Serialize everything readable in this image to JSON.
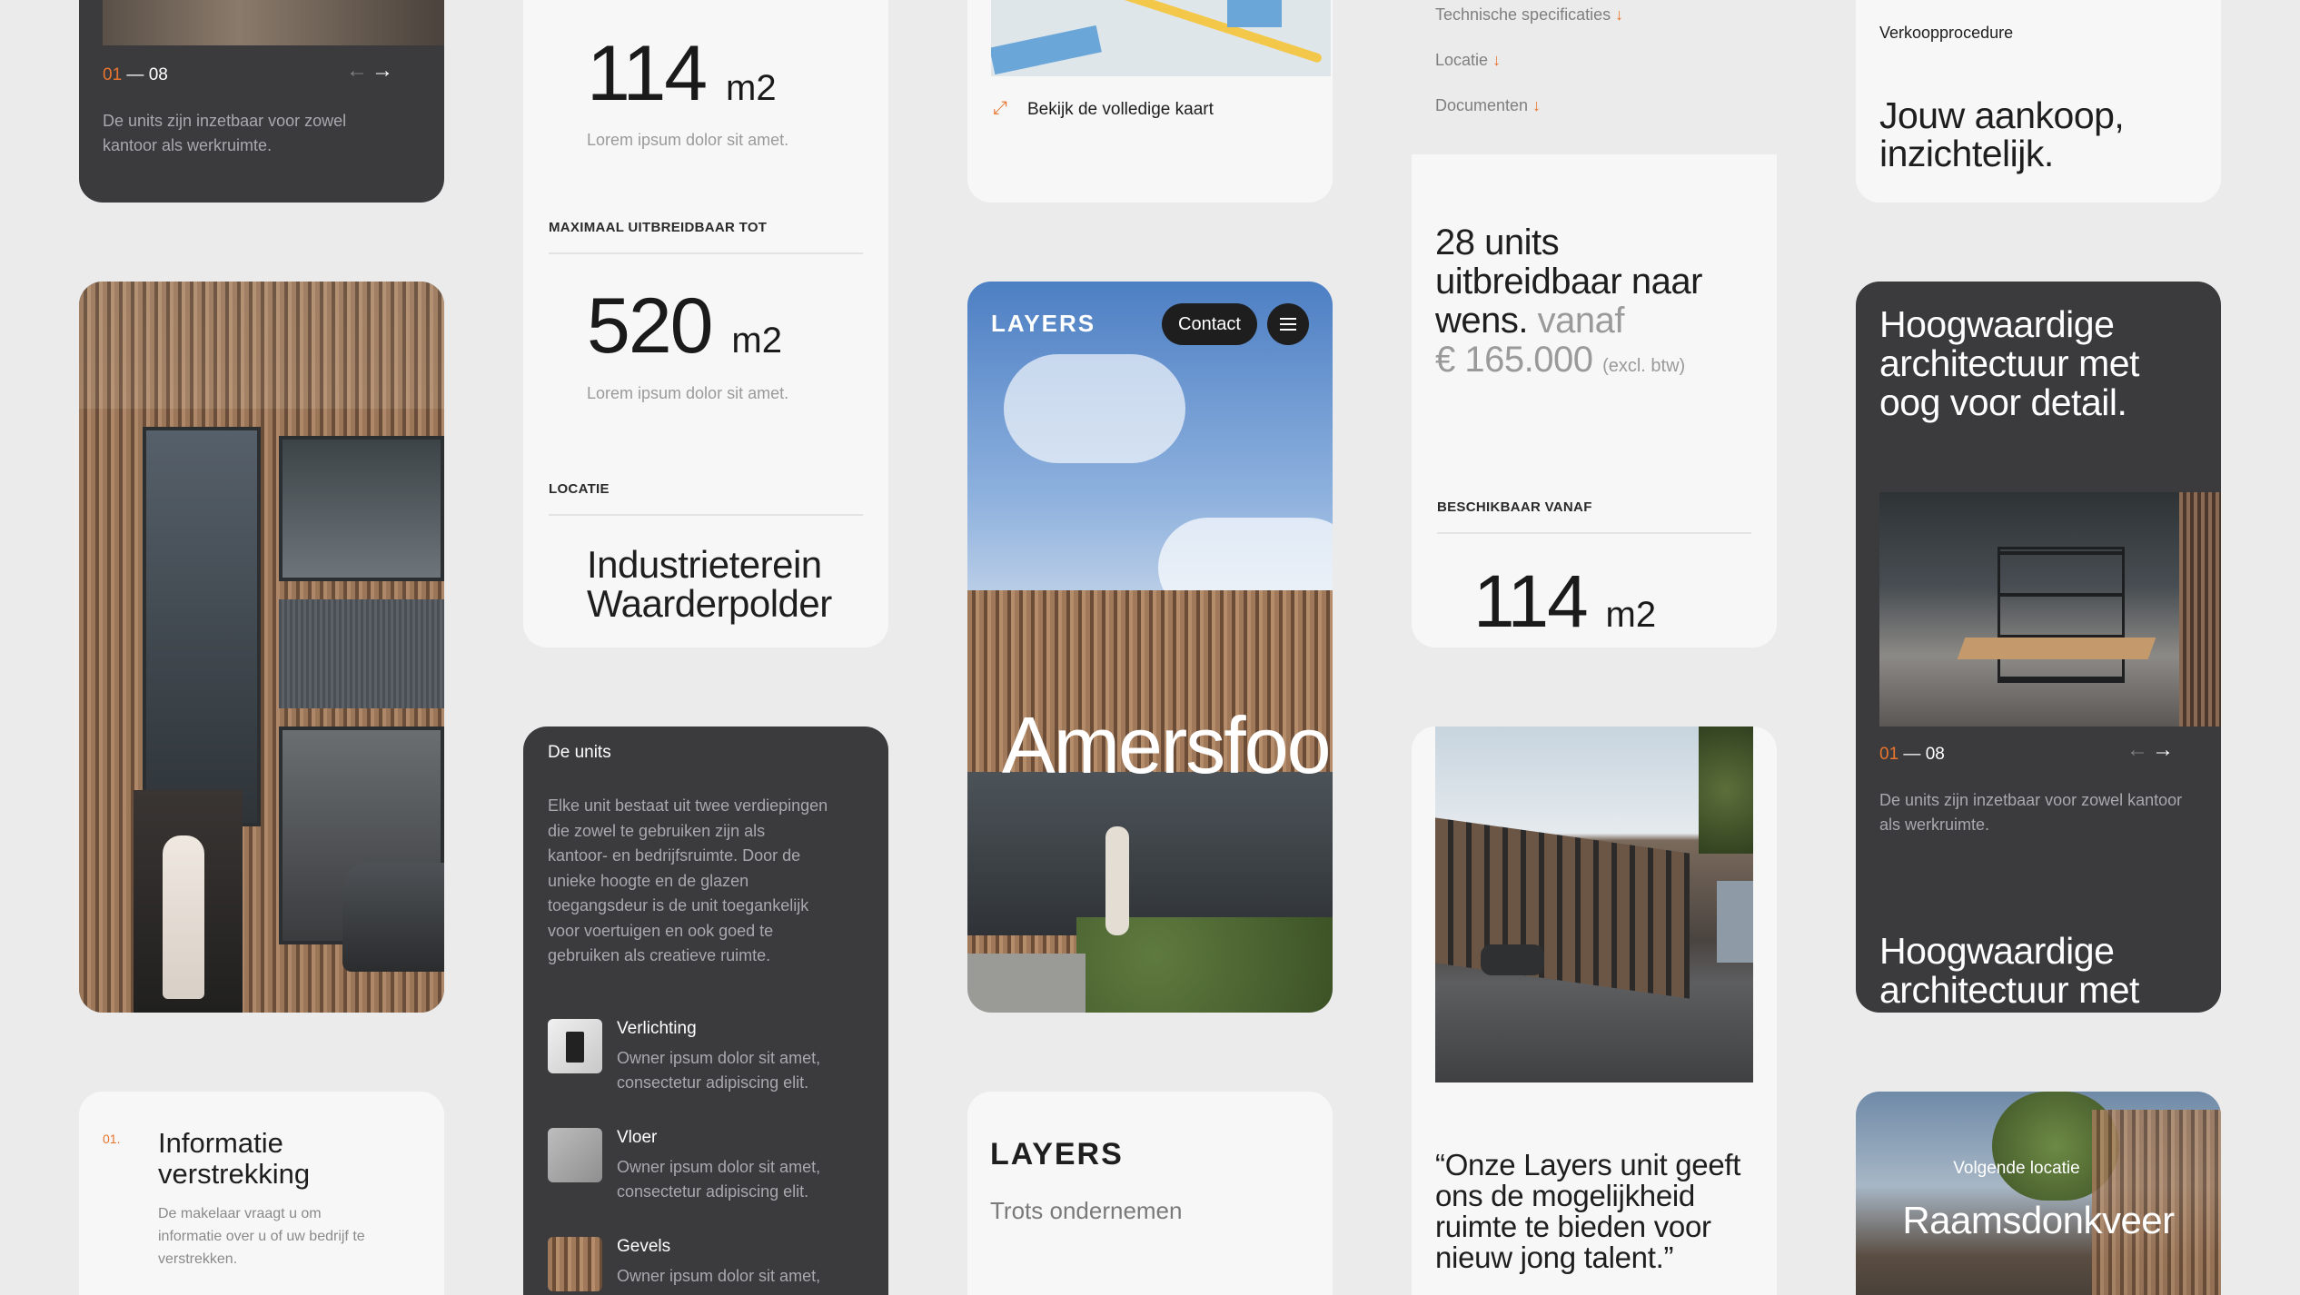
{
  "colors": {
    "accent": "#e8742f",
    "dark_card": "#3b3b3e",
    "light_card": "#f7f7f7",
    "background": "#ebebeb"
  },
  "col1": {
    "slider": {
      "current": "01",
      "total": "— 08",
      "caption": "De units zijn inzetbaar voor zowel kantoor als werkruimte.",
      "prev_icon": "arrow-left-icon",
      "next_icon": "arrow-right-icon"
    },
    "info": {
      "number": "01.",
      "title": "Informatie verstrekking",
      "text": "De makelaar vraagt u om informatie over u of uw bedrijf te verstrekken."
    }
  },
  "col2": {
    "area_1": {
      "value": "114",
      "unit": "m2",
      "caption": "Lorem ipsum dolor sit amet."
    },
    "expand_label": "MAXIMAAL UITBREIDBAAR TOT",
    "area_2": {
      "value": "520",
      "unit": "m2",
      "caption": "Lorem ipsum dolor sit amet."
    },
    "location_label": "LOCATIE",
    "location_value": "Industrieterein Waarderpolder",
    "units": {
      "title": "De units",
      "text": "Elke unit bestaat uit twee verdiepingen die zowel te gebruiken zijn als kantoor- en bedrijfsruimte. Door de unieke hoogte en de glazen toegangsdeur is de unit toegankelijk voor voertuigen en ook goed te gebruiken als creatieve ruimte.",
      "features": [
        {
          "title": "Verlichting",
          "text": "Owner ipsum dolor sit amet, consectetur adipiscing elit."
        },
        {
          "title": "Vloer",
          "text": "Owner ipsum dolor sit amet, consectetur adipiscing elit."
        },
        {
          "title": "Gevels",
          "text": "Owner ipsum dolor sit amet,"
        }
      ]
    }
  },
  "col3": {
    "map": {
      "link": "Bekijk de volledige kaart",
      "icon": "expand-icon"
    },
    "hero": {
      "logo": "LAYERS",
      "contact": "Contact",
      "menu_icon": "hamburger-icon",
      "city": "Amersfoo"
    },
    "brand": {
      "logo": "LAYERS",
      "tagline": "Trots ondernemen"
    }
  },
  "col4": {
    "links": [
      {
        "label": "Technische specificaties",
        "icon": "arrow-down-icon"
      },
      {
        "label": "Locatie",
        "icon": "arrow-down-icon"
      },
      {
        "label": "Documenten",
        "icon": "arrow-down-icon"
      }
    ],
    "offer": {
      "line1": "28 units",
      "line2": "uitbreidbaar naar",
      "line3a": "wens.",
      "line3b": "vanaf",
      "price": "€ 165.000",
      "price_note": "(excl. btw)"
    },
    "available_label": "BESCHIKBAAR VANAF",
    "available": {
      "value": "114",
      "unit": "m2"
    },
    "quote": "“Onze Layers unit geeft ons de mogelijkheid ruimte te bieden voor nieuw jong talent.”"
  },
  "col5": {
    "procedure": {
      "label": "Verkoopprocedure",
      "title": "Jouw aankoop, inzichtelijk."
    },
    "architecture": {
      "title": "Hoogwaardige architectuur met oog voor detail.",
      "slider": {
        "current": "01",
        "total": "— 08"
      },
      "caption": "De units zijn inzetbaar voor zowel kantoor als werkruimte.",
      "title_2": "Hoogwaardige architectuur met"
    },
    "next_location": {
      "label": "Volgende locatie",
      "city": "Raamsdonkveer"
    }
  }
}
